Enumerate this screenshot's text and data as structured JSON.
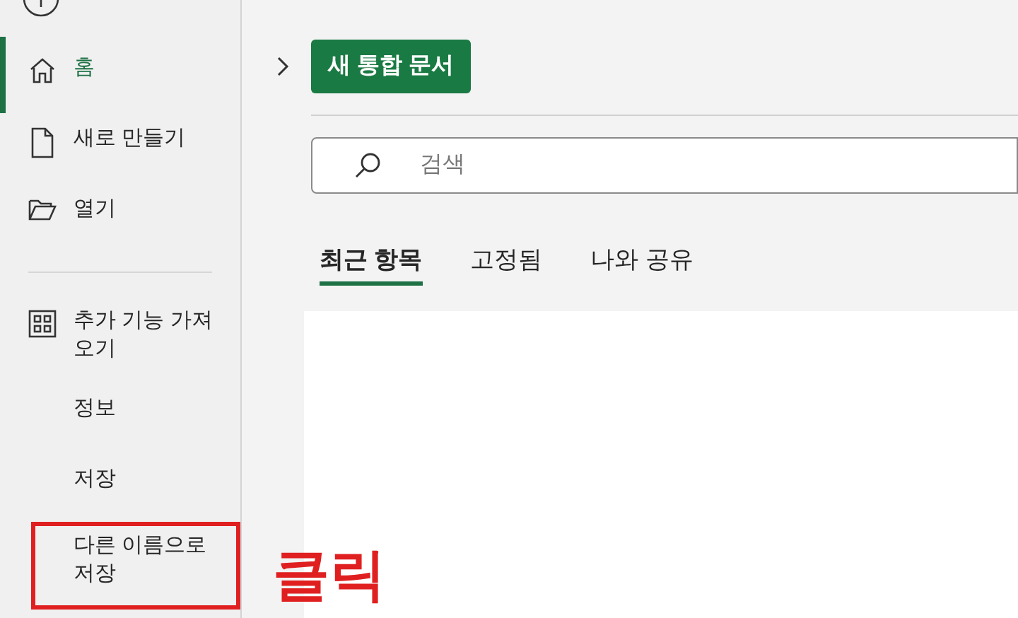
{
  "sidebar": {
    "items": [
      {
        "kind": "home",
        "label": "홈",
        "selected": true,
        "annotated": false
      },
      {
        "kind": "new",
        "label": "새로 만들기",
        "selected": false,
        "annotated": false
      },
      {
        "kind": "open",
        "label": "열기",
        "selected": false,
        "annotated": false
      },
      {
        "kind": "divider"
      },
      {
        "kind": "addins",
        "label": "추가 기능 가져오기",
        "selected": false,
        "annotated": false
      },
      {
        "kind": "text",
        "label": "정보",
        "selected": false,
        "annotated": false
      },
      {
        "kind": "text",
        "label": "저장",
        "selected": false,
        "annotated": false
      },
      {
        "kind": "text",
        "label": "다른 이름으로 저장",
        "selected": false,
        "annotated": true
      }
    ]
  },
  "new_button": "새 통합 문서",
  "search": {
    "placeholder": "검색"
  },
  "tabs": [
    {
      "label": "최근 항목",
      "selected": true
    },
    {
      "label": "고정됨",
      "selected": false
    },
    {
      "label": "나와 공유",
      "selected": false
    }
  ],
  "annotation": {
    "text": "클릭"
  }
}
